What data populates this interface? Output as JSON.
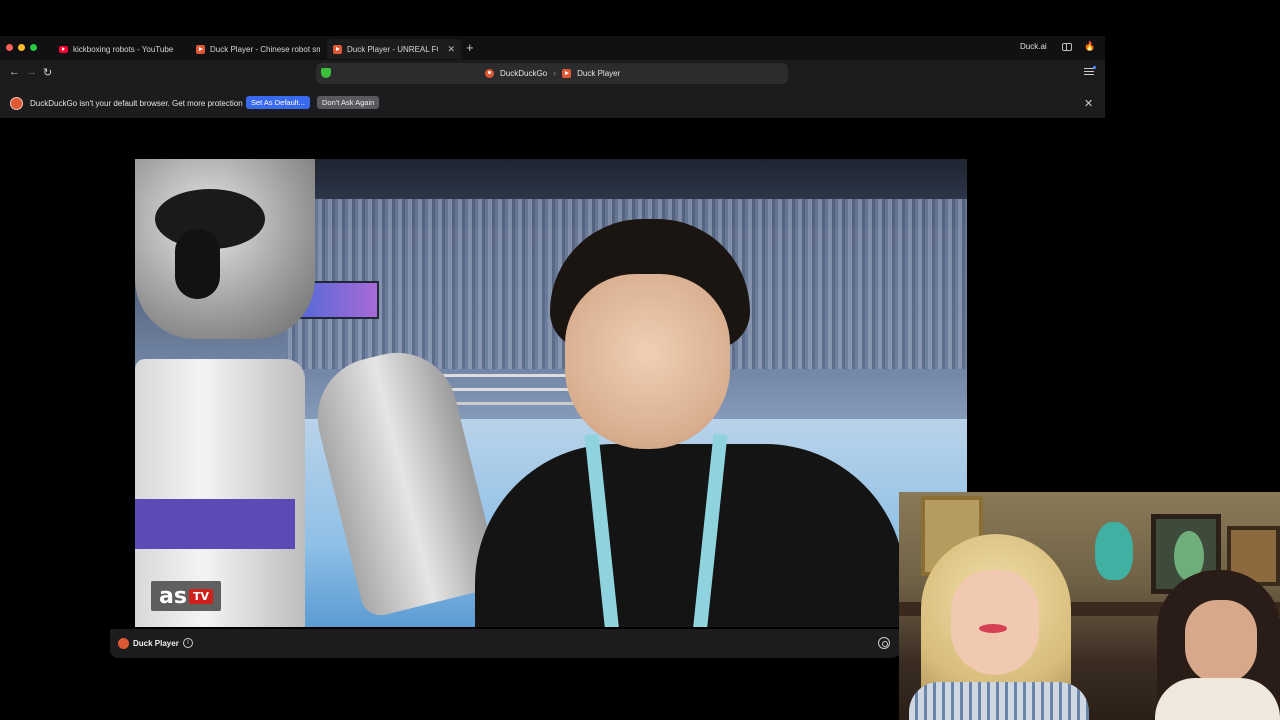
{
  "browser": {
    "tabs": [
      {
        "label": "kickboxing robots - YouTube",
        "favicon": "youtube-icon",
        "active": false
      },
      {
        "label": "Duck Player - Chinese robot sm",
        "favicon": "duck-player-icon",
        "active": false
      },
      {
        "label": "Duck Player - UNREAL FO",
        "favicon": "duck-player-icon",
        "active": true
      }
    ],
    "new_tab_label": "+",
    "duck_ai_label": "Duck.ai",
    "address": {
      "crumb_site": "DuckDuckGo",
      "crumb_page": "Duck Player",
      "separator": "›"
    },
    "nav": {
      "back": "←",
      "forward": "→",
      "reload": "↻"
    }
  },
  "infobar": {
    "message": "DuckDuckGo isn't your default browser. Get more protection",
    "set_default_label": "Set As Default...",
    "dont_ask_label": "Don't Ask Again",
    "close_label": "✕"
  },
  "video": {
    "watermark_main": "as",
    "watermark_sub": "TV"
  },
  "player": {
    "label": "Duck Player",
    "info_label": "i"
  },
  "colors": {
    "accent_blue": "#3969ef",
    "duck_orange": "#de5833",
    "shield_green": "#3cc03c"
  }
}
